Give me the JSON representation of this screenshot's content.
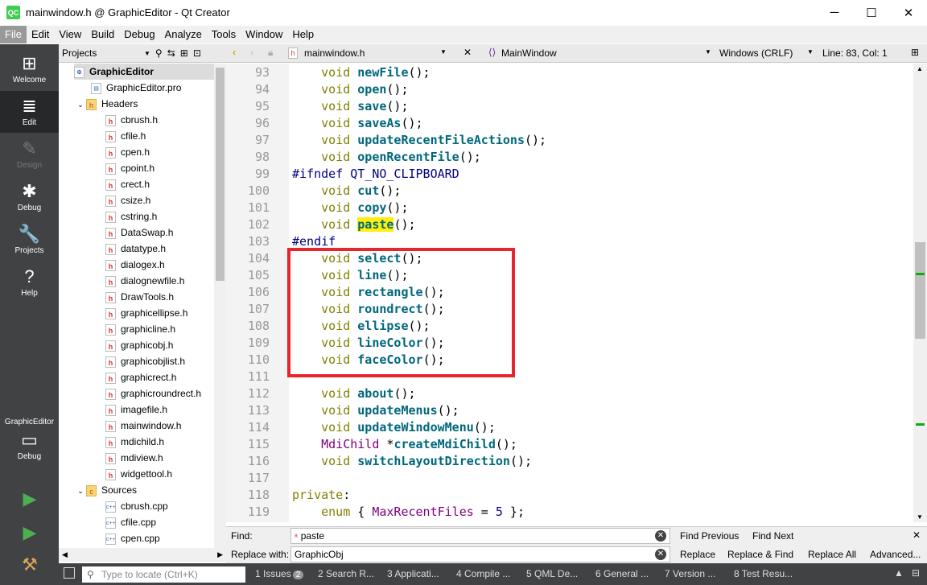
{
  "window": {
    "title": "mainwindow.h @ GraphicEditor - Qt Creator",
    "logo": "QC"
  },
  "menu": [
    "File",
    "Edit",
    "View",
    "Build",
    "Debug",
    "Analyze",
    "Tools",
    "Window",
    "Help"
  ],
  "modes": [
    {
      "label": "Welcome",
      "icon": "⊞"
    },
    {
      "label": "Edit",
      "icon": "≣"
    },
    {
      "label": "Design",
      "icon": "✎"
    },
    {
      "label": "Debug",
      "icon": "✱"
    },
    {
      "label": "Projects",
      "icon": "🔧"
    },
    {
      "label": "Help",
      "icon": "?"
    }
  ],
  "kit": {
    "project": "GraphicEditor",
    "label": "Debug"
  },
  "projects": {
    "header": "Projects",
    "root": "GraphicEditor",
    "pro": "GraphicEditor.pro",
    "headers_label": "Headers",
    "headers": [
      "cbrush.h",
      "cfile.h",
      "cpen.h",
      "cpoint.h",
      "crect.h",
      "csize.h",
      "cstring.h",
      "DataSwap.h",
      "datatype.h",
      "dialogex.h",
      "dialognewfile.h",
      "DrawTools.h",
      "graphicellipse.h",
      "graphicline.h",
      "graphicobj.h",
      "graphicobjlist.h",
      "graphicrect.h",
      "graphicroundrect.h",
      "imagefile.h",
      "mainwindow.h",
      "mdichild.h",
      "mdiview.h",
      "widgettool.h"
    ],
    "sources_label": "Sources",
    "sources": [
      "cbrush.cpp",
      "cfile.cpp",
      "cpen.cpp"
    ]
  },
  "editor": {
    "file": "mainwindow.h",
    "symbol": "MainWindow",
    "encoding": "Windows (CRLF)",
    "position": "Line: 83, Col: 1",
    "lines": [
      {
        "n": "93",
        "segs": [
          [
            "    ",
            ""
          ],
          [
            "void",
            "kw"
          ],
          [
            " ",
            ""
          ],
          [
            "newFile",
            "fn"
          ],
          [
            "();",
            ""
          ]
        ]
      },
      {
        "n": "94",
        "segs": [
          [
            "    ",
            ""
          ],
          [
            "void",
            "kw"
          ],
          [
            " ",
            ""
          ],
          [
            "open",
            "fn"
          ],
          [
            "();",
            ""
          ]
        ]
      },
      {
        "n": "95",
        "segs": [
          [
            "    ",
            ""
          ],
          [
            "void",
            "kw"
          ],
          [
            " ",
            ""
          ],
          [
            "save",
            "fn"
          ],
          [
            "();",
            ""
          ]
        ]
      },
      {
        "n": "96",
        "segs": [
          [
            "    ",
            ""
          ],
          [
            "void",
            "kw"
          ],
          [
            " ",
            ""
          ],
          [
            "saveAs",
            "fn"
          ],
          [
            "();",
            ""
          ]
        ]
      },
      {
        "n": "97",
        "segs": [
          [
            "    ",
            ""
          ],
          [
            "void",
            "kw"
          ],
          [
            " ",
            ""
          ],
          [
            "updateRecentFileActions",
            "fn"
          ],
          [
            "();",
            ""
          ]
        ]
      },
      {
        "n": "98",
        "segs": [
          [
            "    ",
            ""
          ],
          [
            "void",
            "kw"
          ],
          [
            " ",
            ""
          ],
          [
            "openRecentFile",
            "fn"
          ],
          [
            "();",
            ""
          ]
        ]
      },
      {
        "n": "99",
        "segs": [
          [
            "#ifndef QT_NO_CLIPBOARD",
            "pp"
          ]
        ]
      },
      {
        "n": "100",
        "segs": [
          [
            "    ",
            ""
          ],
          [
            "void",
            "kw"
          ],
          [
            " ",
            ""
          ],
          [
            "cut",
            "fn"
          ],
          [
            "();",
            ""
          ]
        ]
      },
      {
        "n": "101",
        "segs": [
          [
            "    ",
            ""
          ],
          [
            "void",
            "kw"
          ],
          [
            " ",
            ""
          ],
          [
            "copy",
            "fn"
          ],
          [
            "();",
            ""
          ]
        ]
      },
      {
        "n": "102",
        "segs": [
          [
            "    ",
            ""
          ],
          [
            "void",
            "kw"
          ],
          [
            " ",
            ""
          ],
          [
            "paste",
            "fn hl"
          ],
          [
            "();",
            ""
          ]
        ]
      },
      {
        "n": "103",
        "segs": [
          [
            "#endif",
            "pp"
          ]
        ]
      },
      {
        "n": "104",
        "segs": [
          [
            "    ",
            ""
          ],
          [
            "void",
            "kw"
          ],
          [
            " ",
            ""
          ],
          [
            "select",
            "fn"
          ],
          [
            "();",
            ""
          ]
        ]
      },
      {
        "n": "105",
        "segs": [
          [
            "    ",
            ""
          ],
          [
            "void",
            "kw"
          ],
          [
            " ",
            ""
          ],
          [
            "line",
            "fn"
          ],
          [
            "();",
            ""
          ]
        ]
      },
      {
        "n": "106",
        "segs": [
          [
            "    ",
            ""
          ],
          [
            "void",
            "kw"
          ],
          [
            " ",
            ""
          ],
          [
            "rectangle",
            "fn"
          ],
          [
            "();",
            ""
          ]
        ]
      },
      {
        "n": "107",
        "segs": [
          [
            "    ",
            ""
          ],
          [
            "void",
            "kw"
          ],
          [
            " ",
            ""
          ],
          [
            "roundrect",
            "fn"
          ],
          [
            "();",
            ""
          ]
        ]
      },
      {
        "n": "108",
        "segs": [
          [
            "    ",
            ""
          ],
          [
            "void",
            "kw"
          ],
          [
            " ",
            ""
          ],
          [
            "ellipse",
            "fn"
          ],
          [
            "();",
            ""
          ]
        ]
      },
      {
        "n": "109",
        "segs": [
          [
            "    ",
            ""
          ],
          [
            "void",
            "kw"
          ],
          [
            " ",
            ""
          ],
          [
            "lineColor",
            "fn"
          ],
          [
            "();",
            ""
          ]
        ]
      },
      {
        "n": "110",
        "segs": [
          [
            "    ",
            ""
          ],
          [
            "void",
            "kw"
          ],
          [
            " ",
            ""
          ],
          [
            "faceColor",
            "fn"
          ],
          [
            "();",
            ""
          ]
        ]
      },
      {
        "n": "111",
        "segs": []
      },
      {
        "n": "112",
        "segs": [
          [
            "    ",
            ""
          ],
          [
            "void",
            "kw"
          ],
          [
            " ",
            ""
          ],
          [
            "about",
            "fn"
          ],
          [
            "();",
            ""
          ]
        ]
      },
      {
        "n": "113",
        "segs": [
          [
            "    ",
            ""
          ],
          [
            "void",
            "kw"
          ],
          [
            " ",
            ""
          ],
          [
            "updateMenus",
            "fn"
          ],
          [
            "();",
            ""
          ]
        ]
      },
      {
        "n": "114",
        "segs": [
          [
            "    ",
            ""
          ],
          [
            "void",
            "kw"
          ],
          [
            " ",
            ""
          ],
          [
            "updateWindowMenu",
            "fn"
          ],
          [
            "();",
            ""
          ]
        ]
      },
      {
        "n": "115",
        "segs": [
          [
            "    ",
            ""
          ],
          [
            "MdiChild",
            "ty"
          ],
          [
            " *",
            ""
          ],
          [
            "createMdiChild",
            "fn"
          ],
          [
            "();",
            ""
          ]
        ]
      },
      {
        "n": "116",
        "segs": [
          [
            "    ",
            ""
          ],
          [
            "void",
            "kw"
          ],
          [
            " ",
            ""
          ],
          [
            "switchLayoutDirection",
            "fn"
          ],
          [
            "();",
            ""
          ]
        ]
      },
      {
        "n": "117",
        "segs": []
      },
      {
        "n": "118",
        "segs": [
          [
            "private",
            "kw"
          ],
          [
            ":",
            ""
          ]
        ]
      },
      {
        "n": "119",
        "segs": [
          [
            "    ",
            ""
          ],
          [
            "enum",
            "kw"
          ],
          [
            " { ",
            ""
          ],
          [
            "MaxRecentFiles",
            "en"
          ],
          [
            " = ",
            ""
          ],
          [
            "5",
            "num"
          ],
          [
            " };",
            ""
          ]
        ]
      }
    ]
  },
  "find": {
    "find_label": "Find:",
    "find_value": "paste",
    "replace_label": "Replace with:",
    "replace_value": "GraphicObj",
    "find_previous": "Find Previous",
    "find_next": "Find Next",
    "replace": "Replace",
    "replace_find": "Replace & Find",
    "replace_all": "Replace All",
    "advanced": "Advanced..."
  },
  "status": {
    "locate_placeholder": "Type to locate (Ctrl+K)",
    "tabs": [
      {
        "label": "1  Issues",
        "badge": "2"
      },
      {
        "label": "2  Search R..."
      },
      {
        "label": "3  Applicati..."
      },
      {
        "label": "4  Compile ..."
      },
      {
        "label": "5  QML De..."
      },
      {
        "label": "6  General ..."
      },
      {
        "label": "7  Version ..."
      },
      {
        "label": "8  Test Resu..."
      }
    ]
  }
}
